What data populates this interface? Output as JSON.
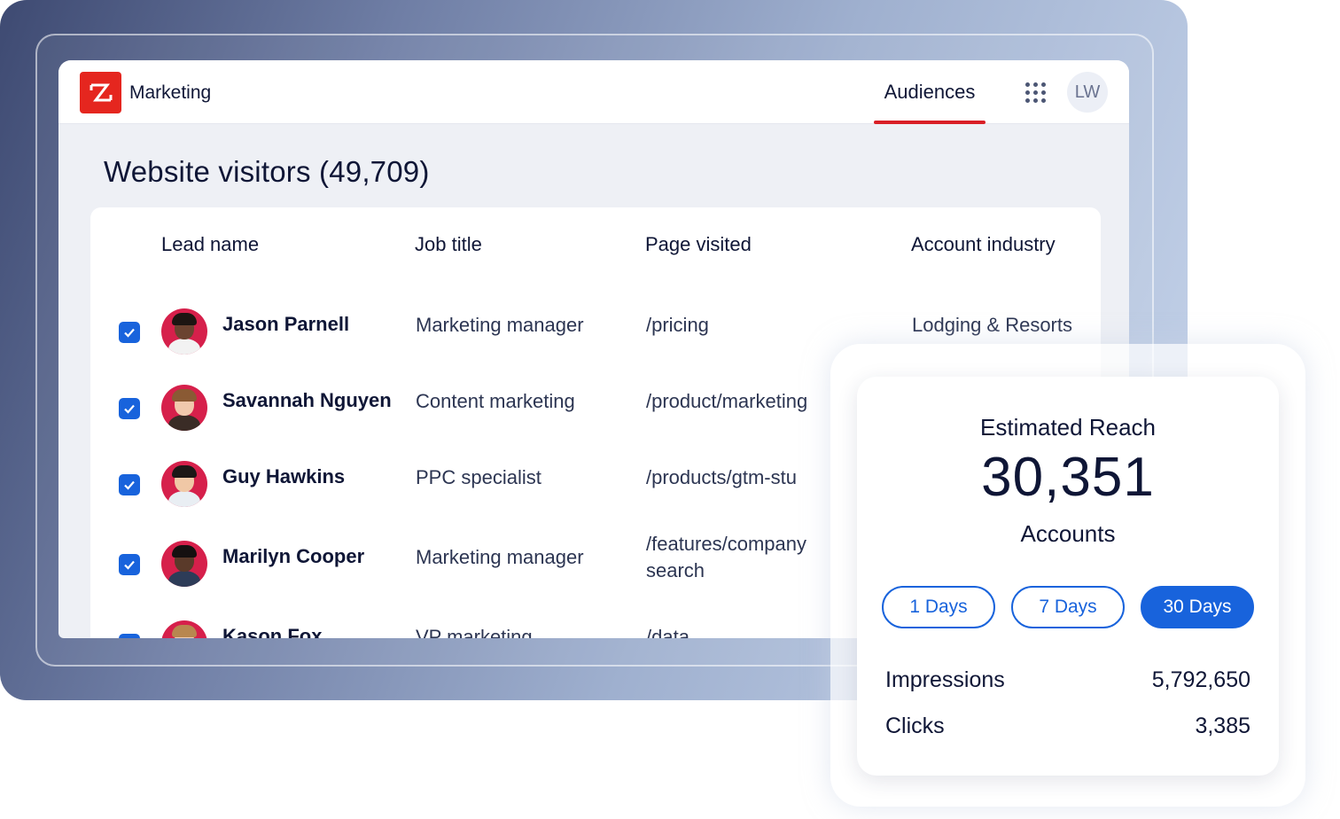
{
  "header": {
    "app_name": "Marketing",
    "nav_tab": "Audiences",
    "user_initials": "LW",
    "accent_color": "#d91f26",
    "logo_color": "#e5261f"
  },
  "page": {
    "title": "Website visitors (49,709)"
  },
  "table": {
    "columns": [
      "Lead name",
      "Job title",
      "Page visited",
      "Account industry"
    ],
    "rows": [
      {
        "name": "Jason Parnell",
        "job_title": "Marketing manager",
        "page_line1": "/pricing",
        "page_line2": "",
        "industry": "Lodging & Resorts",
        "checked": true
      },
      {
        "name": "Savannah Nguyen",
        "job_title": "Content marketing",
        "page_line1": "/product/marketing",
        "page_line2": "",
        "industry": "",
        "checked": true
      },
      {
        "name": "Guy Hawkins",
        "job_title": "PPC specialist",
        "page_line1": "/products/gtm-stu",
        "page_line2": "",
        "industry": "",
        "checked": true
      },
      {
        "name": "Marilyn Cooper",
        "job_title": "Marketing manager",
        "page_line1": "/features/company",
        "page_line2": "search",
        "industry": "",
        "checked": true
      },
      {
        "name": "Kason Fox",
        "job_title": "VP marketing",
        "page_line1": "/data",
        "page_line2": "",
        "industry": "",
        "checked": true
      }
    ]
  },
  "reach_card": {
    "title": "Estimated Reach",
    "value": "30,351",
    "unit": "Accounts",
    "ranges": [
      "1 Days",
      "7 Days",
      "30 Days"
    ],
    "active_range": "30 Days",
    "stats": [
      {
        "label": "Impressions",
        "value": "5,792,650"
      },
      {
        "label": "Clicks",
        "value": "3,385"
      }
    ],
    "accent_color": "#1863dc"
  }
}
